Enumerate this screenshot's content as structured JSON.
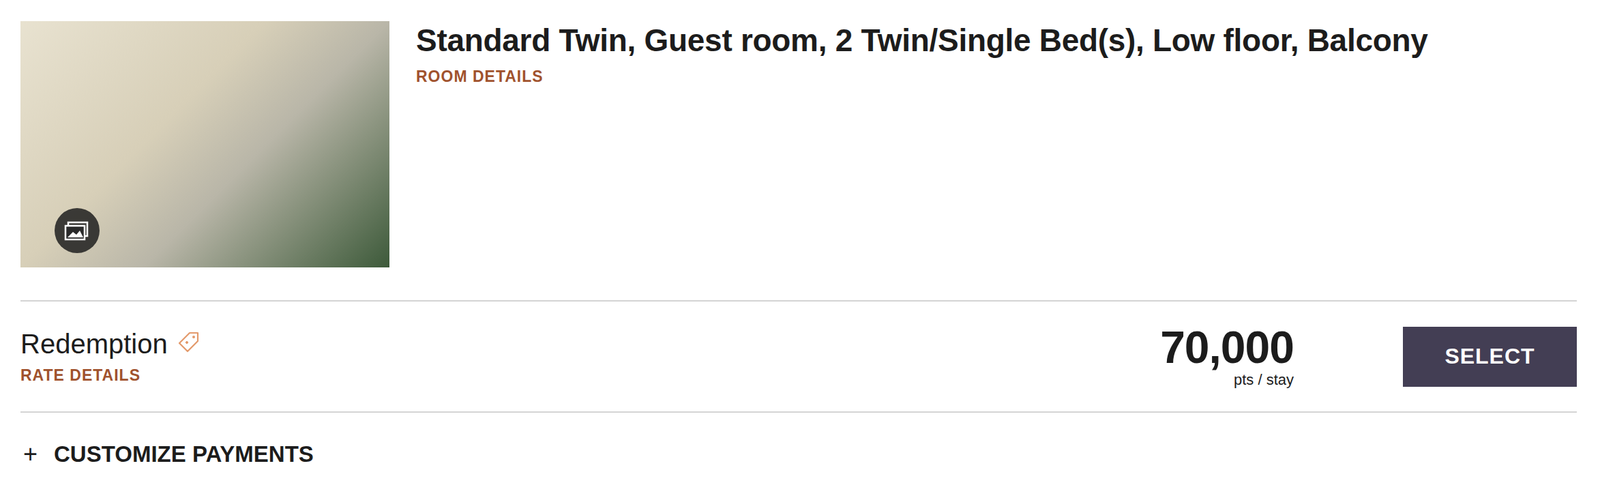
{
  "room": {
    "title": "Standard Twin, Guest room, 2 Twin/Single Bed(s), Low floor, Balcony",
    "details_link": "ROOM DETAILS"
  },
  "rate": {
    "name": "Redemption",
    "details_link": "RATE DETAILS",
    "price": "70,000",
    "unit": "pts / stay",
    "button": "SELECT"
  },
  "customize": {
    "icon": "+",
    "label": "CUSTOMIZE PAYMENTS",
    "expanded": false
  }
}
